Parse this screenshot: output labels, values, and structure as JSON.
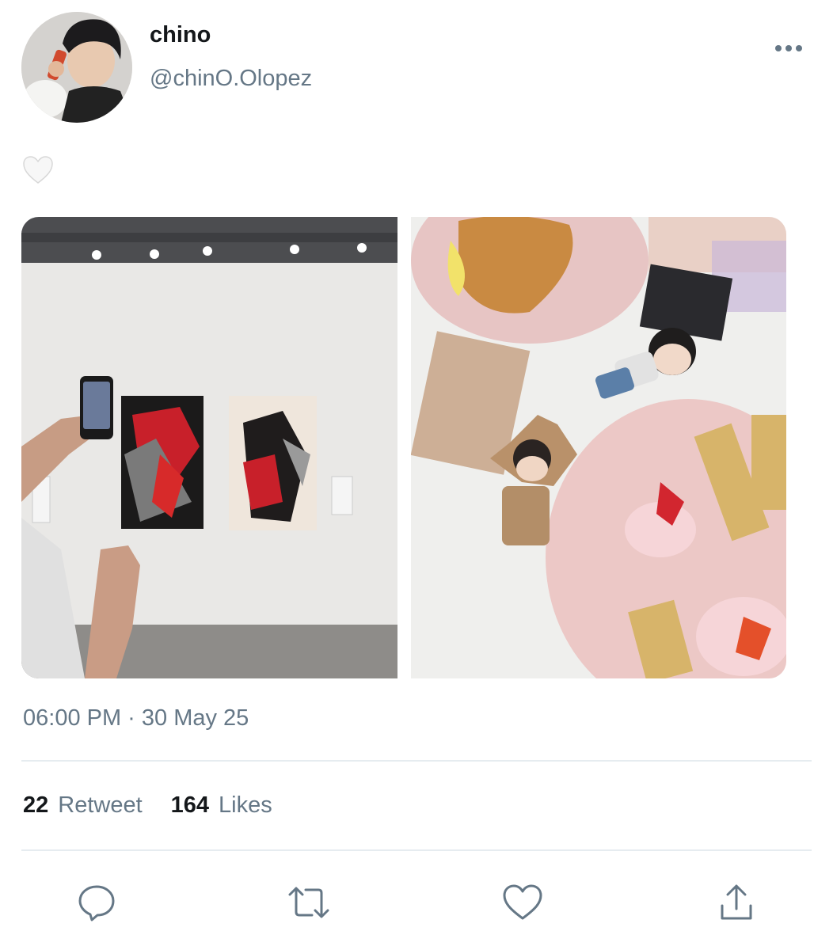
{
  "author": {
    "display_name": "chino",
    "handle": "@chinO.Olopez"
  },
  "tweet": {
    "text_icon": "white-heart-icon",
    "timestamp": "06:00 PM · 30 May 25"
  },
  "stats": {
    "retweets_count": "22",
    "retweets_label": "Retweet",
    "likes_count": "164",
    "likes_label": "Likes"
  },
  "actions": [
    "reply-icon",
    "retweet-icon",
    "like-icon",
    "share-icon"
  ],
  "colors": {
    "text_primary": "#14171a",
    "text_secondary": "#657786",
    "divider": "#e6ecf0"
  }
}
